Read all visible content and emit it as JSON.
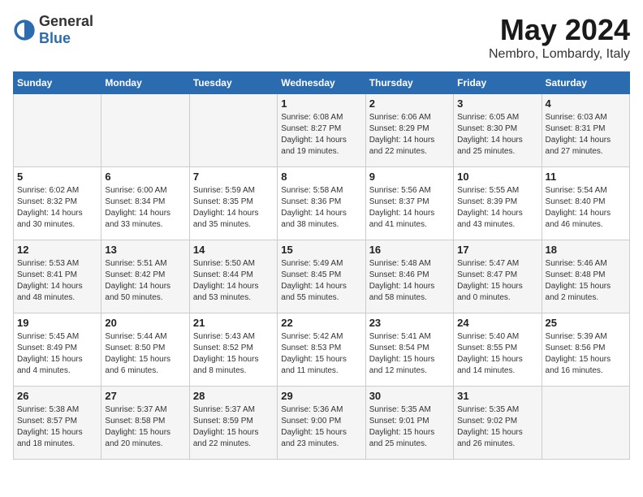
{
  "header": {
    "logo_general": "General",
    "logo_blue": "Blue",
    "main_title": "May 2024",
    "subtitle": "Nembro, Lombardy, Italy"
  },
  "days_of_week": [
    "Sunday",
    "Monday",
    "Tuesday",
    "Wednesday",
    "Thursday",
    "Friday",
    "Saturday"
  ],
  "weeks": [
    [
      {
        "day": "",
        "info": ""
      },
      {
        "day": "",
        "info": ""
      },
      {
        "day": "",
        "info": ""
      },
      {
        "day": "1",
        "info": "Sunrise: 6:08 AM\nSunset: 8:27 PM\nDaylight: 14 hours\nand 19 minutes."
      },
      {
        "day": "2",
        "info": "Sunrise: 6:06 AM\nSunset: 8:29 PM\nDaylight: 14 hours\nand 22 minutes."
      },
      {
        "day": "3",
        "info": "Sunrise: 6:05 AM\nSunset: 8:30 PM\nDaylight: 14 hours\nand 25 minutes."
      },
      {
        "day": "4",
        "info": "Sunrise: 6:03 AM\nSunset: 8:31 PM\nDaylight: 14 hours\nand 27 minutes."
      }
    ],
    [
      {
        "day": "5",
        "info": "Sunrise: 6:02 AM\nSunset: 8:32 PM\nDaylight: 14 hours\nand 30 minutes."
      },
      {
        "day": "6",
        "info": "Sunrise: 6:00 AM\nSunset: 8:34 PM\nDaylight: 14 hours\nand 33 minutes."
      },
      {
        "day": "7",
        "info": "Sunrise: 5:59 AM\nSunset: 8:35 PM\nDaylight: 14 hours\nand 35 minutes."
      },
      {
        "day": "8",
        "info": "Sunrise: 5:58 AM\nSunset: 8:36 PM\nDaylight: 14 hours\nand 38 minutes."
      },
      {
        "day": "9",
        "info": "Sunrise: 5:56 AM\nSunset: 8:37 PM\nDaylight: 14 hours\nand 41 minutes."
      },
      {
        "day": "10",
        "info": "Sunrise: 5:55 AM\nSunset: 8:39 PM\nDaylight: 14 hours\nand 43 minutes."
      },
      {
        "day": "11",
        "info": "Sunrise: 5:54 AM\nSunset: 8:40 PM\nDaylight: 14 hours\nand 46 minutes."
      }
    ],
    [
      {
        "day": "12",
        "info": "Sunrise: 5:53 AM\nSunset: 8:41 PM\nDaylight: 14 hours\nand 48 minutes."
      },
      {
        "day": "13",
        "info": "Sunrise: 5:51 AM\nSunset: 8:42 PM\nDaylight: 14 hours\nand 50 minutes."
      },
      {
        "day": "14",
        "info": "Sunrise: 5:50 AM\nSunset: 8:44 PM\nDaylight: 14 hours\nand 53 minutes."
      },
      {
        "day": "15",
        "info": "Sunrise: 5:49 AM\nSunset: 8:45 PM\nDaylight: 14 hours\nand 55 minutes."
      },
      {
        "day": "16",
        "info": "Sunrise: 5:48 AM\nSunset: 8:46 PM\nDaylight: 14 hours\nand 58 minutes."
      },
      {
        "day": "17",
        "info": "Sunrise: 5:47 AM\nSunset: 8:47 PM\nDaylight: 15 hours\nand 0 minutes."
      },
      {
        "day": "18",
        "info": "Sunrise: 5:46 AM\nSunset: 8:48 PM\nDaylight: 15 hours\nand 2 minutes."
      }
    ],
    [
      {
        "day": "19",
        "info": "Sunrise: 5:45 AM\nSunset: 8:49 PM\nDaylight: 15 hours\nand 4 minutes."
      },
      {
        "day": "20",
        "info": "Sunrise: 5:44 AM\nSunset: 8:50 PM\nDaylight: 15 hours\nand 6 minutes."
      },
      {
        "day": "21",
        "info": "Sunrise: 5:43 AM\nSunset: 8:52 PM\nDaylight: 15 hours\nand 8 minutes."
      },
      {
        "day": "22",
        "info": "Sunrise: 5:42 AM\nSunset: 8:53 PM\nDaylight: 15 hours\nand 11 minutes."
      },
      {
        "day": "23",
        "info": "Sunrise: 5:41 AM\nSunset: 8:54 PM\nDaylight: 15 hours\nand 12 minutes."
      },
      {
        "day": "24",
        "info": "Sunrise: 5:40 AM\nSunset: 8:55 PM\nDaylight: 15 hours\nand 14 minutes."
      },
      {
        "day": "25",
        "info": "Sunrise: 5:39 AM\nSunset: 8:56 PM\nDaylight: 15 hours\nand 16 minutes."
      }
    ],
    [
      {
        "day": "26",
        "info": "Sunrise: 5:38 AM\nSunset: 8:57 PM\nDaylight: 15 hours\nand 18 minutes."
      },
      {
        "day": "27",
        "info": "Sunrise: 5:37 AM\nSunset: 8:58 PM\nDaylight: 15 hours\nand 20 minutes."
      },
      {
        "day": "28",
        "info": "Sunrise: 5:37 AM\nSunset: 8:59 PM\nDaylight: 15 hours\nand 22 minutes."
      },
      {
        "day": "29",
        "info": "Sunrise: 5:36 AM\nSunset: 9:00 PM\nDaylight: 15 hours\nand 23 minutes."
      },
      {
        "day": "30",
        "info": "Sunrise: 5:35 AM\nSunset: 9:01 PM\nDaylight: 15 hours\nand 25 minutes."
      },
      {
        "day": "31",
        "info": "Sunrise: 5:35 AM\nSunset: 9:02 PM\nDaylight: 15 hours\nand 26 minutes."
      },
      {
        "day": "",
        "info": ""
      }
    ]
  ]
}
